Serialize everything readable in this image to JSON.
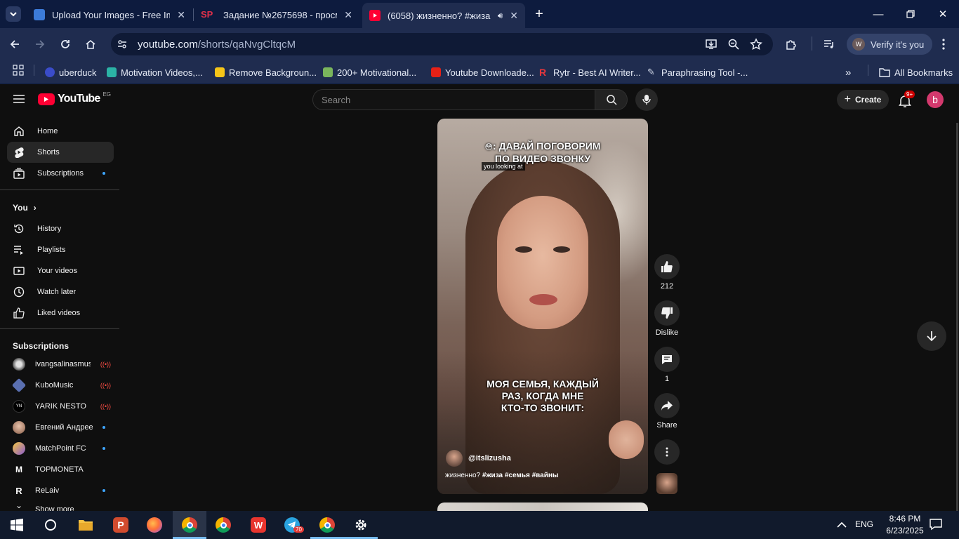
{
  "browser": {
    "tabs": [
      {
        "title": "Upload Your Images - Free Imag",
        "icon": "upload-images-favicon",
        "active": false
      },
      {
        "title": "Задание №2675698 - просмотр",
        "icon": "sp-favicon",
        "active": false
      },
      {
        "title": "(6058) жизненно? #жиза #",
        "icon": "youtube-favicon",
        "active": true
      }
    ],
    "url_host": "youtube.com",
    "url_path": "/shorts/qaNvgCltqcM",
    "verify_label": "Verify it's you",
    "bookmarks": [
      {
        "label": "uberduck",
        "icon": "uberduck-icon",
        "color": "#3a4cc9"
      },
      {
        "label": "Motivation Videos,...",
        "icon": "motivation-icon",
        "color": "#2bb3a6"
      },
      {
        "label": "Remove Backgroun...",
        "icon": "removebg-icon",
        "color": "#f5c518"
      },
      {
        "label": "200+ Motivational...",
        "icon": "shopify-icon",
        "color": "#7ab55c"
      },
      {
        "label": "Youtube Downloade...",
        "icon": "download-icon",
        "color": "#e62117"
      },
      {
        "label": "Rytr - Best AI Writer...",
        "icon": "rytr-icon",
        "color": "#e5373d"
      },
      {
        "label": "Paraphrasing Tool -...",
        "icon": "pen-icon",
        "color": "#cfd6e6"
      }
    ],
    "all_bookmarks": "All Bookmarks"
  },
  "youtube": {
    "logo_text": "YouTube",
    "region": "EG",
    "search_placeholder": "Search",
    "create_label": "Create",
    "notif_badge": "9+",
    "avatar_letter": "b",
    "nav": [
      {
        "label": "Home",
        "icon": "home-icon"
      },
      {
        "label": "Shorts",
        "icon": "shorts-icon",
        "selected": true
      },
      {
        "label": "Subscriptions",
        "icon": "subscriptions-icon"
      }
    ],
    "you_heading": "You",
    "you_items": [
      {
        "label": "History",
        "icon": "history-icon"
      },
      {
        "label": "Playlists",
        "icon": "playlists-icon"
      },
      {
        "label": "Your videos",
        "icon": "your-videos-icon"
      },
      {
        "label": "Watch later",
        "icon": "watch-later-icon"
      },
      {
        "label": "Liked videos",
        "icon": "liked-videos-icon"
      }
    ],
    "subs_heading": "Subscriptions",
    "subscriptions": [
      {
        "name": "ivangsalinasmus...",
        "indicator": "live",
        "color": "#8a8a8a"
      },
      {
        "name": "KuboMusic",
        "indicator": "live",
        "color": "#5a6fb0"
      },
      {
        "name": "YARIK NESTO",
        "indicator": "live",
        "color": "#1b1b1b"
      },
      {
        "name": "Евгений Андреев",
        "indicator": "dot",
        "color": "#c9a08a"
      },
      {
        "name": "MatchPoint FC",
        "indicator": "dot",
        "color": "#8a5cd0"
      },
      {
        "name": "TOPMONETA",
        "indicator": "none",
        "color": "#0f0f0f"
      },
      {
        "name": "ReLaiv",
        "indicator": "dot",
        "color": "#0f0f0f"
      },
      {
        "name": "Show more",
        "indicator": "none",
        "color": "#0f0f0f"
      }
    ],
    "short": {
      "caption_top_line1": ": ДАВАЙ ПОГОВОРИМ",
      "caption_top_line2": "ПО ВИДЕО ЗВОНКУ",
      "overlay_sub": "you looking at",
      "caption_bottom_line1": "МОЯ СЕМЬЯ, КАЖДЫЙ",
      "caption_bottom_line2": "РАЗ, КОГДА МНЕ",
      "caption_bottom_line3": "КТО-ТО ЗВОНИТ:",
      "channel": "@itslizusha",
      "description_plain": "жизненно? ",
      "description_tags": "#жиза #семья #вайны"
    },
    "actions": {
      "likes": "212",
      "dislike_label": "Dislike",
      "comments": "1",
      "share_label": "Share"
    }
  },
  "taskbar": {
    "apps": [
      {
        "name": "start",
        "icon": "windows-icon"
      },
      {
        "name": "search",
        "icon": "cortana-icon"
      },
      {
        "name": "explorer",
        "icon": "folder-icon"
      },
      {
        "name": "pdf",
        "icon": "p-app-icon"
      },
      {
        "name": "firefox",
        "icon": "firefox-icon"
      },
      {
        "name": "chrome-profile",
        "icon": "chrome-profile-icon"
      },
      {
        "name": "chrome",
        "icon": "chrome-icon"
      },
      {
        "name": "wps",
        "icon": "wps-icon"
      },
      {
        "name": "telegram",
        "icon": "telegram-icon",
        "badge": "70"
      },
      {
        "name": "chrome-2",
        "icon": "chrome-profile-2-icon"
      },
      {
        "name": "settings",
        "icon": "settings-icon"
      }
    ],
    "lang": "ENG",
    "time": "8:46 PM",
    "date": "6/23/2025"
  }
}
